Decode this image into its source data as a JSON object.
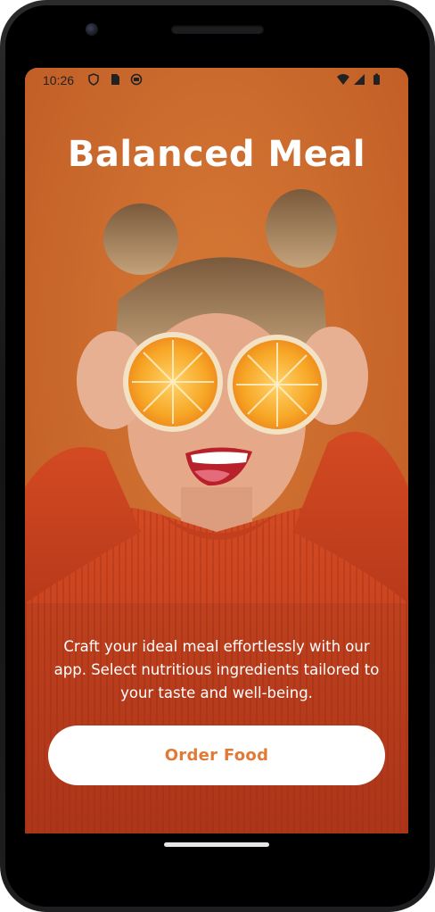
{
  "status_bar": {
    "time": "10:26",
    "left_icons": [
      "shield-icon",
      "sim-card-icon",
      "app-notification-icon"
    ],
    "right_icons": [
      "wifi-icon",
      "cellular-signal-icon",
      "battery-icon"
    ]
  },
  "screen": {
    "title": "Balanced Meal",
    "description": "Craft your ideal meal effortlessly with our app. Select nutritious ingredients tailored to your taste and well-being.",
    "order_button_label": "Order Food"
  },
  "colors": {
    "background_orange": "#cf6f2c",
    "sweater_red": "#c8401e",
    "button_text": "#e07a36",
    "button_bg": "#ffffff",
    "text_white": "#ffffff"
  }
}
